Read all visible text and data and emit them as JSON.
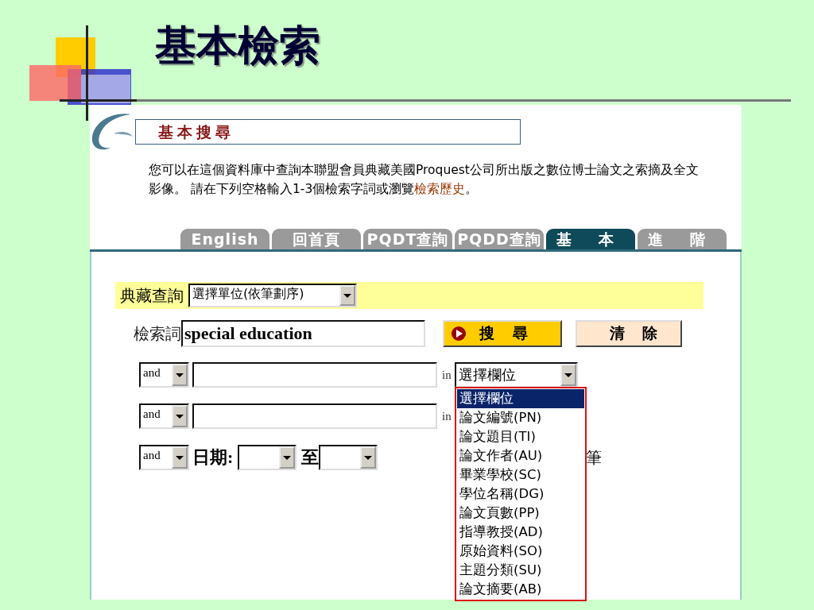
{
  "slide": {
    "title": "基本檢索"
  },
  "page": {
    "heading": "基本搜尋",
    "intro": {
      "text": "您可以在這個資料庫中查詢本聯盟會員典藏美國Proquest公司所出版之數位博士論文之索摘及全文影像。 請在下列空格輸入1-3個檢索字詞或瀏覽",
      "link": "檢索歷史",
      "end": "。"
    },
    "tabs": [
      {
        "label": "English",
        "selected": false
      },
      {
        "label": "回首頁",
        "selected": false
      },
      {
        "label": "PQDT查詢",
        "selected": false
      },
      {
        "label": "PQDD查詢",
        "selected": false
      },
      {
        "label": "基 本",
        "selected": true
      },
      {
        "label": "進 階",
        "selected": false
      }
    ],
    "collection": {
      "label": "典藏查詢",
      "select": "選擇單位(依筆劃序)"
    },
    "keyword": {
      "label": "檢索詞",
      "value": "special education"
    },
    "buttons": [
      {
        "label": "搜 尋",
        "kind": "search"
      },
      {
        "label": "清 除",
        "kind": "clear"
      }
    ],
    "term_rows": [
      {
        "operator": "and",
        "in": "in",
        "field": "選擇欄位"
      },
      {
        "operator": "and",
        "in": "in"
      }
    ],
    "date_row": {
      "operator": "and",
      "label": "日期:",
      "to": "至",
      "trailing": "筆"
    },
    "field_dropdown": {
      "options": [
        {
          "label": "選擇欄位",
          "selected": true
        },
        {
          "label": "論文編號(PN)",
          "selected": false
        },
        {
          "label": "論文題目(TI)",
          "selected": false
        },
        {
          "label": "論文作者(AU)",
          "selected": false
        },
        {
          "label": "畢業學校(SC)",
          "selected": false
        },
        {
          "label": "學位名稱(DG)",
          "selected": false
        },
        {
          "label": "論文頁數(PP)",
          "selected": false
        },
        {
          "label": "指導教授(AD)",
          "selected": false
        },
        {
          "label": "原始資料(SO)",
          "selected": false
        },
        {
          "label": "主題分類(SU)",
          "selected": false
        },
        {
          "label": "論文摘要(AB)",
          "selected": false
        }
      ]
    }
  }
}
